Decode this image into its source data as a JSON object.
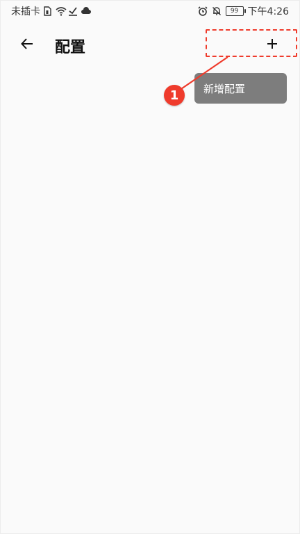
{
  "status_bar": {
    "carrier": "未插卡",
    "battery": "99",
    "time": "下午4:26",
    "icons_left": [
      "sim-icon",
      "wifi-icon",
      "check-icon",
      "cloud-icon"
    ],
    "icons_right": [
      "alarm-icon",
      "bell-off-icon",
      "battery-icon"
    ]
  },
  "app_bar": {
    "title": "配置",
    "back_icon": "arrow-left-icon",
    "add_icon": "plus-icon"
  },
  "tooltip": {
    "text": "新增配置"
  },
  "annotation": {
    "badge": "1",
    "color": "#ef3b2c"
  }
}
